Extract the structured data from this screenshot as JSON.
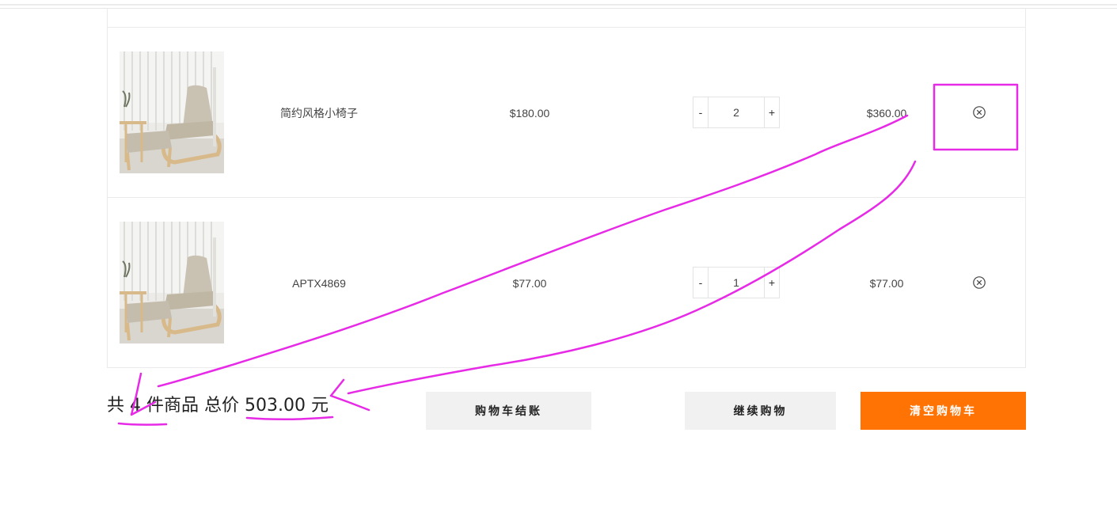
{
  "cart": {
    "items": [
      {
        "name": "简约风格小椅子",
        "price": "$180.00",
        "qty_minus": "-",
        "quantity": "2",
        "qty_plus": "+",
        "subtotal": "$360.00",
        "image_icon": "armchair-product-image",
        "remove_icon": "remove-circle-x-icon"
      },
      {
        "name": "APTX4869",
        "price": "$77.00",
        "qty_minus": "-",
        "quantity": "1",
        "qty_plus": "+",
        "subtotal": "$77.00",
        "image_icon": "armchair-product-image",
        "remove_icon": "remove-circle-x-icon"
      }
    ]
  },
  "summary": {
    "prefix": "共",
    "count": "4",
    "middle": "件商品 总价",
    "total": "503.00",
    "suffix": "元"
  },
  "actions": {
    "checkout_label": "购物车结账",
    "continue_label": "继续购物",
    "clear_label": "清空购物车"
  },
  "colors": {
    "accent": "#ff7204",
    "annotation": "#e62ae6",
    "button_gray": "#f1f1f1"
  }
}
